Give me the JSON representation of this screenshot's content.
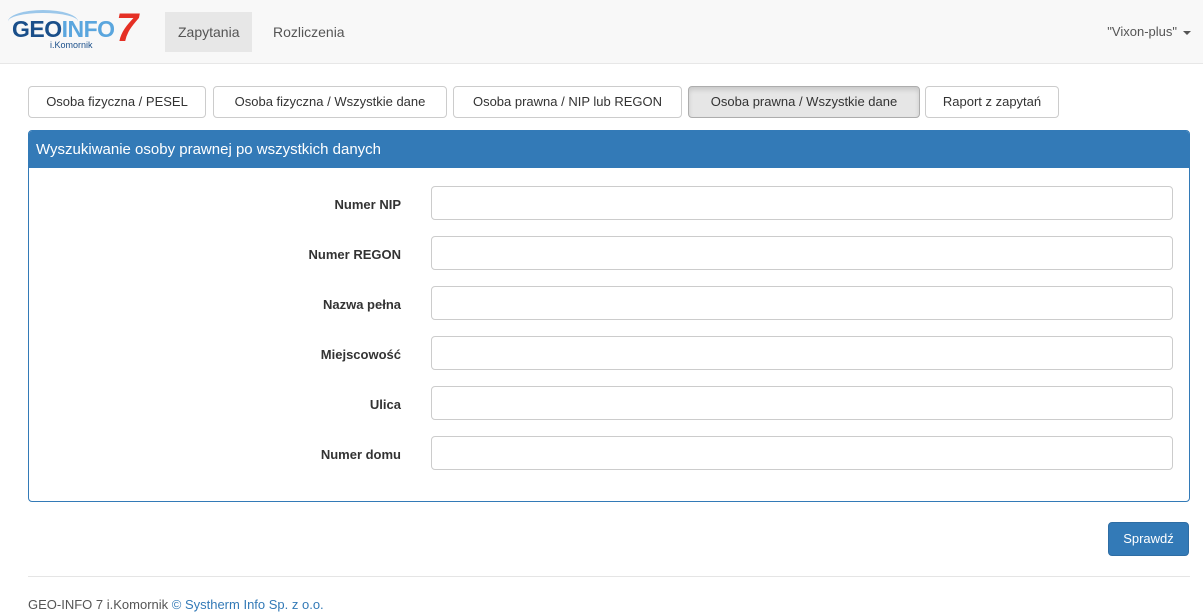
{
  "brand": {
    "logo_geo": "GEO",
    "logo_info": "INFO",
    "logo_seven": "7",
    "logo_sub": "i.Komornik"
  },
  "nav": {
    "items": [
      {
        "label": "Zapytania",
        "active": true
      },
      {
        "label": "Rozliczenia",
        "active": false
      }
    ],
    "user": "\"Vixon-plus\""
  },
  "tabs": [
    {
      "label": "Osoba fizyczna / PESEL",
      "active": false
    },
    {
      "label": "Osoba fizyczna / Wszystkie dane",
      "active": false
    },
    {
      "label": "Osoba prawna / NIP lub REGON",
      "active": false
    },
    {
      "label": "Osoba prawna / Wszystkie dane",
      "active": true
    },
    {
      "label": "Raport z zapytań",
      "active": false
    }
  ],
  "panel": {
    "title": "Wyszukiwanie osoby prawnej po wszystkich danych",
    "fields": [
      {
        "label": "Numer NIP",
        "value": ""
      },
      {
        "label": "Numer REGON",
        "value": ""
      },
      {
        "label": "Nazwa pełna",
        "value": ""
      },
      {
        "label": "Miejscowość",
        "value": ""
      },
      {
        "label": "Ulica",
        "value": ""
      },
      {
        "label": "Numer domu",
        "value": ""
      }
    ]
  },
  "submit_label": "Sprawdź",
  "footer": {
    "text": "GEO-INFO 7 i.Komornik ",
    "link": "© Systherm Info Sp. z o.o."
  },
  "colors": {
    "primary": "#337ab7",
    "logo_red": "#e53025",
    "logo_blue": "#1a4f8a"
  }
}
